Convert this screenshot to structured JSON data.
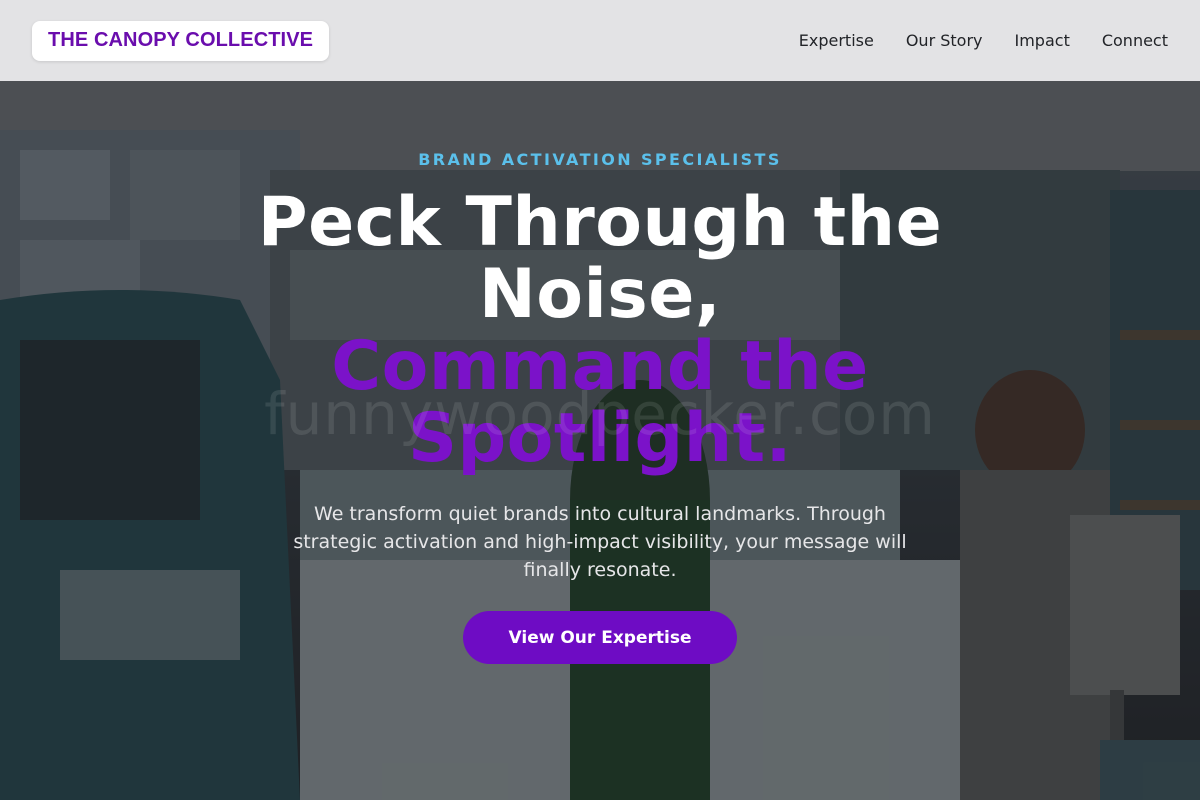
{
  "header": {
    "logo": "THE CANOPY COLLECTIVE",
    "nav": [
      "Expertise",
      "Our Story",
      "Impact",
      "Connect"
    ]
  },
  "hero": {
    "eyebrow": "BRAND ACTIVATION SPECIALISTS",
    "headline_line1": "Peck Through the Noise,",
    "headline_accent": "Command the Spotlight.",
    "subtext": "We transform quiet brands into cultural landmarks. Through strategic activation and high-impact visibility, your message will finally resonate.",
    "cta_label": "View Our Expertise",
    "background_image": "shop-interior-photo",
    "watermark": "funnywoodpecker.com"
  },
  "colors": {
    "brand_purple": "#6a0dad",
    "accent_purple": "#7b12c9",
    "eyebrow_blue": "#5bc0eb",
    "header_bg": "#e8e8ea"
  }
}
